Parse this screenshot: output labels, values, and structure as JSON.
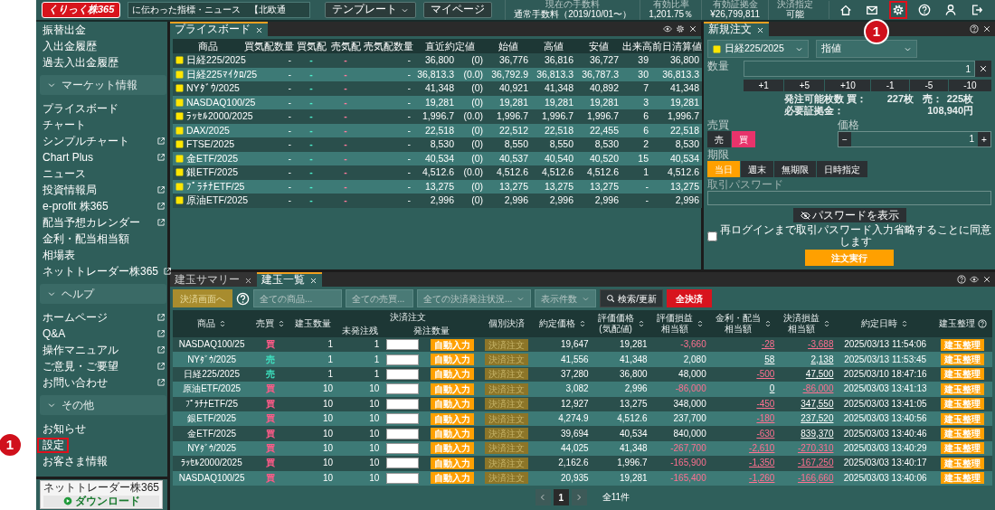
{
  "header": {
    "logo": "くりっく株365",
    "ticker": "に伝わった指標・ニュース　【北欧通",
    "buttons": [
      {
        "label": "テンプレート",
        "dropdown": true
      },
      {
        "label": "マイページ",
        "dropdown": false
      }
    ],
    "stats": [
      {
        "label": "現在の手数料",
        "value": "通常手数料（2019/10/01〜）"
      },
      {
        "label": "有効比率",
        "value": "1,201.75％"
      },
      {
        "label": "有効証拠金",
        "value": "¥26,799,811"
      },
      {
        "label": "決済指定",
        "value": "可能"
      }
    ],
    "icons": [
      {
        "kind": "home",
        "highlighted": false
      },
      {
        "kind": "mail",
        "highlighted": false
      },
      {
        "kind": "settings",
        "highlighted": true,
        "callout": "1"
      },
      {
        "kind": "help",
        "highlighted": false
      },
      {
        "kind": "user",
        "highlighted": false
      },
      {
        "kind": "logout",
        "highlighted": false
      }
    ]
  },
  "sidebar": {
    "items": [
      {
        "kind": "link",
        "label": "振替出金",
        "external": false,
        "highlighted": false
      },
      {
        "kind": "link",
        "label": "入出金履歴",
        "external": false,
        "highlighted": false
      },
      {
        "kind": "link",
        "label": "過去入出金履歴",
        "external": false,
        "highlighted": false
      },
      {
        "kind": "section",
        "label": "マーケット情報",
        "expanded": true
      },
      {
        "kind": "link",
        "label": "プライスボード",
        "external": false,
        "highlighted": false
      },
      {
        "kind": "link",
        "label": "チャート",
        "external": false,
        "highlighted": false
      },
      {
        "kind": "link",
        "label": "シンプルチャート",
        "external": true,
        "highlighted": false
      },
      {
        "kind": "link",
        "label": "Chart Plus",
        "external": true,
        "highlighted": false
      },
      {
        "kind": "link",
        "label": "ニュース",
        "external": false,
        "highlighted": false
      },
      {
        "kind": "link",
        "label": "投資情報局",
        "external": true,
        "highlighted": false
      },
      {
        "kind": "link",
        "label": "e-profit 株365",
        "external": true,
        "highlighted": false
      },
      {
        "kind": "link",
        "label": "配当予想カレンダー",
        "external": true,
        "highlighted": false
      },
      {
        "kind": "link",
        "label": "金利・配当相当額",
        "external": false,
        "highlighted": false
      },
      {
        "kind": "link",
        "label": "相場表",
        "external": false,
        "highlighted": false
      },
      {
        "kind": "link",
        "label": "ネットトレーダー株365",
        "external": true,
        "highlighted": false
      },
      {
        "kind": "section",
        "label": "ヘルプ",
        "expanded": true
      },
      {
        "kind": "link",
        "label": "ホームページ",
        "external": true,
        "highlighted": false
      },
      {
        "kind": "link",
        "label": "Q&A",
        "external": true,
        "highlighted": false
      },
      {
        "kind": "link",
        "label": "操作マニュアル",
        "external": true,
        "highlighted": false
      },
      {
        "kind": "link",
        "label": "ご意見・ご要望",
        "external": true,
        "highlighted": false
      },
      {
        "kind": "link",
        "label": "お問い合わせ",
        "external": true,
        "highlighted": false
      },
      {
        "kind": "section",
        "label": "その他",
        "expanded": true
      },
      {
        "kind": "link",
        "label": "お知らせ",
        "external": false,
        "highlighted": false
      },
      {
        "kind": "link",
        "label": "設定",
        "external": false,
        "highlighted": true,
        "callout": "1"
      },
      {
        "kind": "link",
        "label": "お客さま情報",
        "external": false,
        "highlighted": false
      }
    ],
    "download": {
      "caption": "ネットトレーダー株365",
      "label": "ダウンロード"
    }
  },
  "price_board": {
    "tabs": [
      {
        "label": "プライスボード",
        "selected": true
      }
    ],
    "tools": [
      {
        "kind": "eye"
      },
      {
        "kind": "settings"
      },
      {
        "kind": "close"
      }
    ],
    "columns": [
      "商品",
      "買気配数量",
      "買気配",
      "売気配",
      "売気配数量",
      "直近約定値",
      "始値",
      "高値",
      "安値",
      "出来高",
      "前日清算値"
    ],
    "rows": [
      {
        "name": "日経225/2025",
        "bid_qty": "-",
        "bid": "-",
        "ask": "-",
        "ask_qty": "-",
        "last": "36,800",
        "change": "(0)",
        "open": "36,776",
        "high": "36,816",
        "low": "36,727",
        "volume": "39",
        "prev_settle": "36,800"
      },
      {
        "name": "日経225ﾏｲｸﾛ/25",
        "bid_qty": "-",
        "bid": "-",
        "ask": "-",
        "ask_qty": "-",
        "last": "36,813.3",
        "change": "(0.0)",
        "open": "36,792.9",
        "high": "36,813.3",
        "low": "36,787.3",
        "volume": "30",
        "prev_settle": "36,813.3"
      },
      {
        "name": "NYﾀﾞｳ/2025",
        "bid_qty": "-",
        "bid": "-",
        "ask": "-",
        "ask_qty": "-",
        "last": "41,348",
        "change": "(0)",
        "open": "40,921",
        "high": "41,348",
        "low": "40,892",
        "volume": "7",
        "prev_settle": "41,348"
      },
      {
        "name": "NASDAQ100/25",
        "bid_qty": "-",
        "bid": "-",
        "ask": "-",
        "ask_qty": "-",
        "last": "19,281",
        "change": "(0)",
        "open": "19,281",
        "high": "19,281",
        "low": "19,281",
        "volume": "3",
        "prev_settle": "19,281"
      },
      {
        "name": "ﾗｯｾﾙ2000/2025",
        "bid_qty": "-",
        "bid": "-",
        "ask": "-",
        "ask_qty": "-",
        "last": "1,996.7",
        "change": "(0.0)",
        "open": "1,996.7",
        "high": "1,996.7",
        "low": "1,996.7",
        "volume": "6",
        "prev_settle": "1,996.7"
      },
      {
        "name": "DAX/2025",
        "bid_qty": "-",
        "bid": "-",
        "ask": "-",
        "ask_qty": "-",
        "last": "22,518",
        "change": "(0)",
        "open": "22,512",
        "high": "22,518",
        "low": "22,455",
        "volume": "6",
        "prev_settle": "22,518"
      },
      {
        "name": "FTSE/2025",
        "bid_qty": "-",
        "bid": "-",
        "ask": "-",
        "ask_qty": "-",
        "last": "8,530",
        "change": "(0)",
        "open": "8,550",
        "high": "8,550",
        "low": "8,530",
        "volume": "2",
        "prev_settle": "8,530"
      },
      {
        "name": "金ETF/2025",
        "bid_qty": "-",
        "bid": "-",
        "ask": "-",
        "ask_qty": "-",
        "last": "40,534",
        "change": "(0)",
        "open": "40,537",
        "high": "40,540",
        "low": "40,520",
        "volume": "15",
        "prev_settle": "40,534"
      },
      {
        "name": "銀ETF/2025",
        "bid_qty": "-",
        "bid": "-",
        "ask": "-",
        "ask_qty": "-",
        "last": "4,512.6",
        "change": "(0.0)",
        "open": "4,512.6",
        "high": "4,512.6",
        "low": "4,512.6",
        "volume": "1",
        "prev_settle": "4,512.6"
      },
      {
        "name": "ﾌﾟﾗﾁﾅETF/25",
        "bid_qty": "-",
        "bid": "-",
        "ask": "-",
        "ask_qty": "-",
        "last": "13,275",
        "change": "(0)",
        "open": "13,275",
        "high": "13,275",
        "low": "13,275",
        "volume": "-",
        "prev_settle": "13,275"
      },
      {
        "name": "原油ETF/2025",
        "bid_qty": "-",
        "bid": "-",
        "ask": "-",
        "ask_qty": "-",
        "last": "2,996",
        "change": "(0)",
        "open": "2,996",
        "high": "2,996",
        "low": "2,996",
        "volume": "-",
        "prev_settle": "2,996"
      }
    ]
  },
  "new_order": {
    "tabs": [
      {
        "label": "新規注文",
        "selected": true
      }
    ],
    "tools": [
      {
        "kind": "help"
      },
      {
        "kind": "close"
      }
    ],
    "product": "日経225/2025",
    "order_type": "指値",
    "quantity": {
      "label": "数量",
      "value": "1"
    },
    "steps": [
      "+1",
      "+5",
      "+10",
      "-1",
      "-5",
      "-10"
    ],
    "availability": [
      "発注可能枚数 買：",
      "227枚",
      "売：",
      "225枚"
    ],
    "margin": [
      "必要証拠金：",
      "108,940円"
    ],
    "side": {
      "label": "売買",
      "options": [
        {
          "label": "売",
          "selected": false
        },
        {
          "label": "買",
          "selected": true
        }
      ]
    },
    "price": {
      "label": "価格",
      "minus": "−",
      "value": "1",
      "plus": "+"
    },
    "expiry": {
      "label": "期限",
      "options": [
        {
          "label": "当日",
          "selected": true
        },
        {
          "label": "週末",
          "selected": false
        },
        {
          "label": "無期限",
          "selected": false
        },
        {
          "label": "日時指定",
          "selected": false
        }
      ]
    },
    "password": {
      "label": "取引パスワード",
      "show_button": "パスワードを表示"
    },
    "remember": {
      "label": "再ログインまで取引パスワード入力省略することに同意します",
      "checked": false
    },
    "submit": "注文実行"
  },
  "positions": {
    "tabs": [
      {
        "label": "建玉サマリー",
        "selected": false
      },
      {
        "label": "建玉一覧",
        "selected": true
      }
    ],
    "tools": [
      {
        "kind": "help"
      },
      {
        "kind": "eye"
      },
      {
        "kind": "close"
      }
    ],
    "toolbar": {
      "settle_screen": "決済画面へ",
      "product_filter": {
        "placeholder": "全ての商品..."
      },
      "side_filter": {
        "placeholder": "全ての売買..."
      },
      "status_filter": "全ての決済発注状況...",
      "count_filter": "表示件数",
      "search": "検索/更新",
      "settle_all": "全決済"
    },
    "columns": [
      {
        "kind": "plain",
        "label": "商品",
        "sortable": true
      },
      {
        "kind": "plain",
        "label": "売買",
        "sortable": true
      },
      {
        "kind": "plain",
        "label": "建玉数量",
        "sortable": false
      },
      {
        "kind": "group",
        "label": "決済注文",
        "children": [
          "未発注残",
          "発注数量"
        ]
      },
      {
        "kind": "plain",
        "label": "個別決済",
        "sortable": false
      },
      {
        "kind": "plain",
        "label": "約定価格",
        "sortable": true
      },
      {
        "kind": "plain",
        "lines": [
          "評価価格",
          "(気配値)"
        ],
        "sortable": true
      },
      {
        "kind": "plain",
        "lines": [
          "評価損益",
          "相当額"
        ],
        "sortable": true
      },
      {
        "kind": "plain",
        "lines": [
          "金利・配当",
          "相当額"
        ],
        "sortable": true
      },
      {
        "kind": "plain",
        "lines": [
          "決済損益",
          "相当額"
        ],
        "sortable": true
      },
      {
        "kind": "plain",
        "label": "約定日時",
        "sortable": true
      },
      {
        "kind": "plain",
        "label": "建玉整理",
        "sortable": false,
        "help": true
      }
    ],
    "rows": [
      {
        "name": "NASDAQ100/25",
        "side": {
          "label": "買",
          "kind": "buy"
        },
        "qty": "1",
        "remaining": "1",
        "autofill": "自動入力",
        "settle": "決済注文",
        "price": "19,647",
        "eval_price": "19,281",
        "eval_pl": {
          "text": "-3,660",
          "loss": true
        },
        "interest": {
          "text": "-28",
          "loss": true
        },
        "settle_pl": {
          "text": "-3,688",
          "loss": true
        },
        "date": "2025/03/13 11:54:06",
        "organize": "建玉整理"
      },
      {
        "name": "NYﾀﾞｳ/2025",
        "side": {
          "label": "売",
          "kind": "sell"
        },
        "qty": "1",
        "remaining": "1",
        "autofill": "自動入力",
        "settle": "決済注文",
        "price": "41,556",
        "eval_price": "41,348",
        "eval_pl": {
          "text": "2,080",
          "loss": false
        },
        "interest": {
          "text": "58",
          "loss": false
        },
        "settle_pl": {
          "text": "2,138",
          "loss": false
        },
        "date": "2025/03/13 11:53:45",
        "organize": "建玉整理"
      },
      {
        "name": "日経225/2025",
        "side": {
          "label": "売",
          "kind": "sell"
        },
        "qty": "1",
        "remaining": "1",
        "autofill": "自動入力",
        "settle": "決済注文",
        "price": "37,280",
        "eval_price": "36,800",
        "eval_pl": {
          "text": "48,000",
          "loss": false
        },
        "interest": {
          "text": "-500",
          "loss": true
        },
        "settle_pl": {
          "text": "47,500",
          "loss": false
        },
        "date": "2025/03/10 18:47:16",
        "organize": "建玉整理"
      },
      {
        "name": "原油ETF/2025",
        "side": {
          "label": "買",
          "kind": "buy"
        },
        "qty": "10",
        "remaining": "10",
        "autofill": "自動入力",
        "settle": "決済注文",
        "price": "3,082",
        "eval_price": "2,996",
        "eval_pl": {
          "text": "-86,000",
          "loss": true
        },
        "interest": {
          "text": "0",
          "loss": false
        },
        "settle_pl": {
          "text": "-86,000",
          "loss": true
        },
        "date": "2025/03/03 13:41:13",
        "organize": "建玉整理"
      },
      {
        "name": "ﾌﾟﾗﾁﾅETF/25",
        "side": {
          "label": "買",
          "kind": "buy"
        },
        "qty": "10",
        "remaining": "10",
        "autofill": "自動入力",
        "settle": "決済注文",
        "price": "12,927",
        "eval_price": "13,275",
        "eval_pl": {
          "text": "348,000",
          "loss": false
        },
        "interest": {
          "text": "-450",
          "loss": true
        },
        "settle_pl": {
          "text": "347,550",
          "loss": false
        },
        "date": "2025/03/03 13:41:05",
        "organize": "建玉整理"
      },
      {
        "name": "銀ETF/2025",
        "side": {
          "label": "買",
          "kind": "buy"
        },
        "qty": "10",
        "remaining": "10",
        "autofill": "自動入力",
        "settle": "決済注文",
        "price": "4,274.9",
        "eval_price": "4,512.6",
        "eval_pl": {
          "text": "237,700",
          "loss": false
        },
        "interest": {
          "text": "-180",
          "loss": true
        },
        "settle_pl": {
          "text": "237,520",
          "loss": false
        },
        "date": "2025/03/03 13:40:56",
        "organize": "建玉整理"
      },
      {
        "name": "金ETF/2025",
        "side": {
          "label": "買",
          "kind": "buy"
        },
        "qty": "10",
        "remaining": "10",
        "autofill": "自動入力",
        "settle": "決済注文",
        "price": "39,694",
        "eval_price": "40,534",
        "eval_pl": {
          "text": "840,000",
          "loss": false
        },
        "interest": {
          "text": "-630",
          "loss": true
        },
        "settle_pl": {
          "text": "839,370",
          "loss": false
        },
        "date": "2025/03/03 13:40:46",
        "organize": "建玉整理"
      },
      {
        "name": "NYﾀﾞｳ/2025",
        "side": {
          "label": "買",
          "kind": "buy"
        },
        "qty": "10",
        "remaining": "10",
        "autofill": "自動入力",
        "settle": "決済注文",
        "price": "44,025",
        "eval_price": "41,348",
        "eval_pl": {
          "text": "-267,700",
          "loss": true
        },
        "interest": {
          "text": "-2,610",
          "loss": true
        },
        "settle_pl": {
          "text": "-270,310",
          "loss": true
        },
        "date": "2025/03/03 13:40:29",
        "organize": "建玉整理"
      },
      {
        "name": "ﾗｯｾﾙ2000/2025",
        "side": {
          "label": "買",
          "kind": "buy"
        },
        "qty": "10",
        "remaining": "10",
        "autofill": "自動入力",
        "settle": "決済注文",
        "price": "2,162.6",
        "eval_price": "1,996.7",
        "eval_pl": {
          "text": "-165,900",
          "loss": true
        },
        "interest": {
          "text": "-1,350",
          "loss": true
        },
        "settle_pl": {
          "text": "-167,250",
          "loss": true
        },
        "date": "2025/03/03 13:40:17",
        "organize": "建玉整理"
      },
      {
        "name": "NASDAQ100/25",
        "side": {
          "label": "買",
          "kind": "buy"
        },
        "qty": "10",
        "remaining": "10",
        "autofill": "自動入力",
        "settle": "決済注文",
        "price": "20,935",
        "eval_price": "19,281",
        "eval_pl": {
          "text": "-165,400",
          "loss": true
        },
        "interest": {
          "text": "-1,260",
          "loss": true
        },
        "settle_pl": {
          "text": "-166,660",
          "loss": true
        },
        "date": "2025/03/03 13:40:06",
        "organize": "建玉整理"
      }
    ],
    "pagination": {
      "pages": [
        {
          "label": "1",
          "selected": true
        }
      ],
      "total": "全11件"
    }
  }
}
